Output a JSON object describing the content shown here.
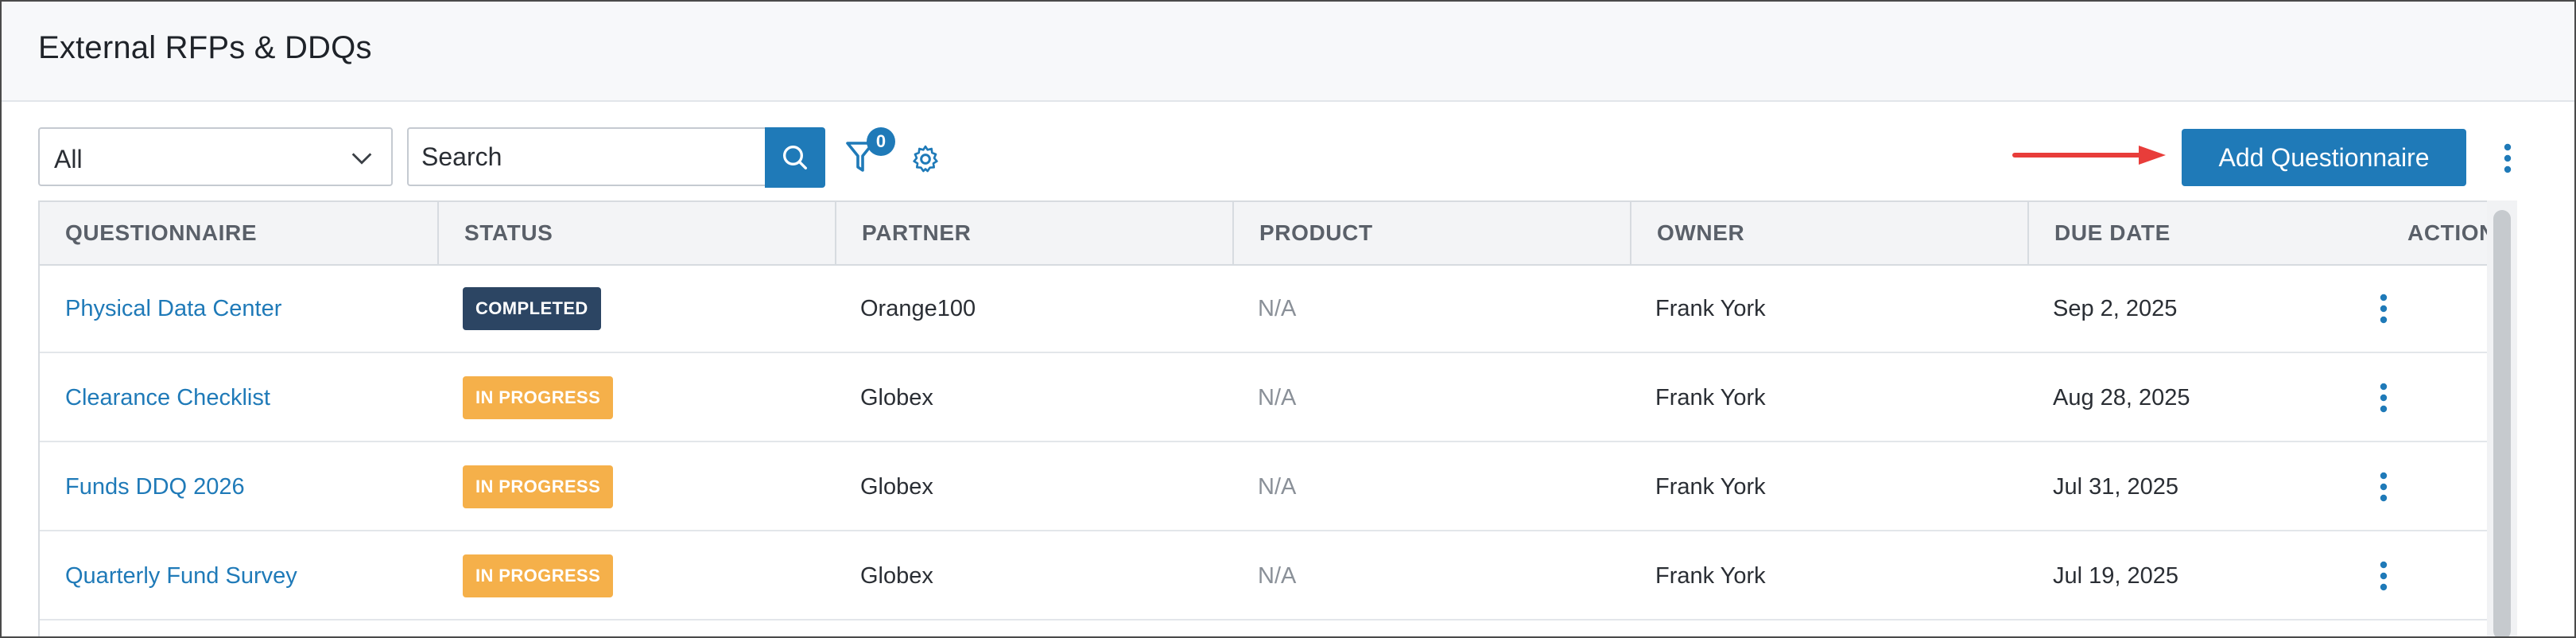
{
  "page": {
    "title": "External RFPs & DDQs"
  },
  "toolbar": {
    "filter_select": {
      "value": "All",
      "icon": "chevron-down-icon"
    },
    "search": {
      "placeholder": "Search",
      "icon": "search-icon"
    },
    "filter_badge_count": "0",
    "add_button_label": "Add Questionnaire",
    "accent_color": "#1f7ab8",
    "arrow_color": "#e83d3a"
  },
  "table": {
    "columns": [
      "QUESTIONNAIRE",
      "STATUS",
      "PARTNER",
      "PRODUCT",
      "OWNER",
      "DUE DATE",
      "ACTIONS"
    ],
    "rows": [
      {
        "questionnaire": "Physical Data Center",
        "status": "COMPLETED",
        "status_type": "completed",
        "partner": "Orange100",
        "product": "N/A",
        "owner": "Frank York",
        "due_date": "Sep 2, 2025"
      },
      {
        "questionnaire": "Clearance Checklist",
        "status": "IN PROGRESS",
        "status_type": "inprogress",
        "partner": "Globex",
        "product": "N/A",
        "owner": "Frank York",
        "due_date": "Aug 28, 2025"
      },
      {
        "questionnaire": "Funds DDQ 2026",
        "status": "IN PROGRESS",
        "status_type": "inprogress",
        "partner": "Globex",
        "product": "N/A",
        "owner": "Frank York",
        "due_date": "Jul 31, 2025"
      },
      {
        "questionnaire": "Quarterly Fund Survey",
        "status": "IN PROGRESS",
        "status_type": "inprogress",
        "partner": "Globex",
        "product": "N/A",
        "owner": "Frank York",
        "due_date": "Jul 19, 2025"
      }
    ],
    "status_colors": {
      "completed": "#2c4563",
      "inprogress": "#f5b04a"
    }
  }
}
